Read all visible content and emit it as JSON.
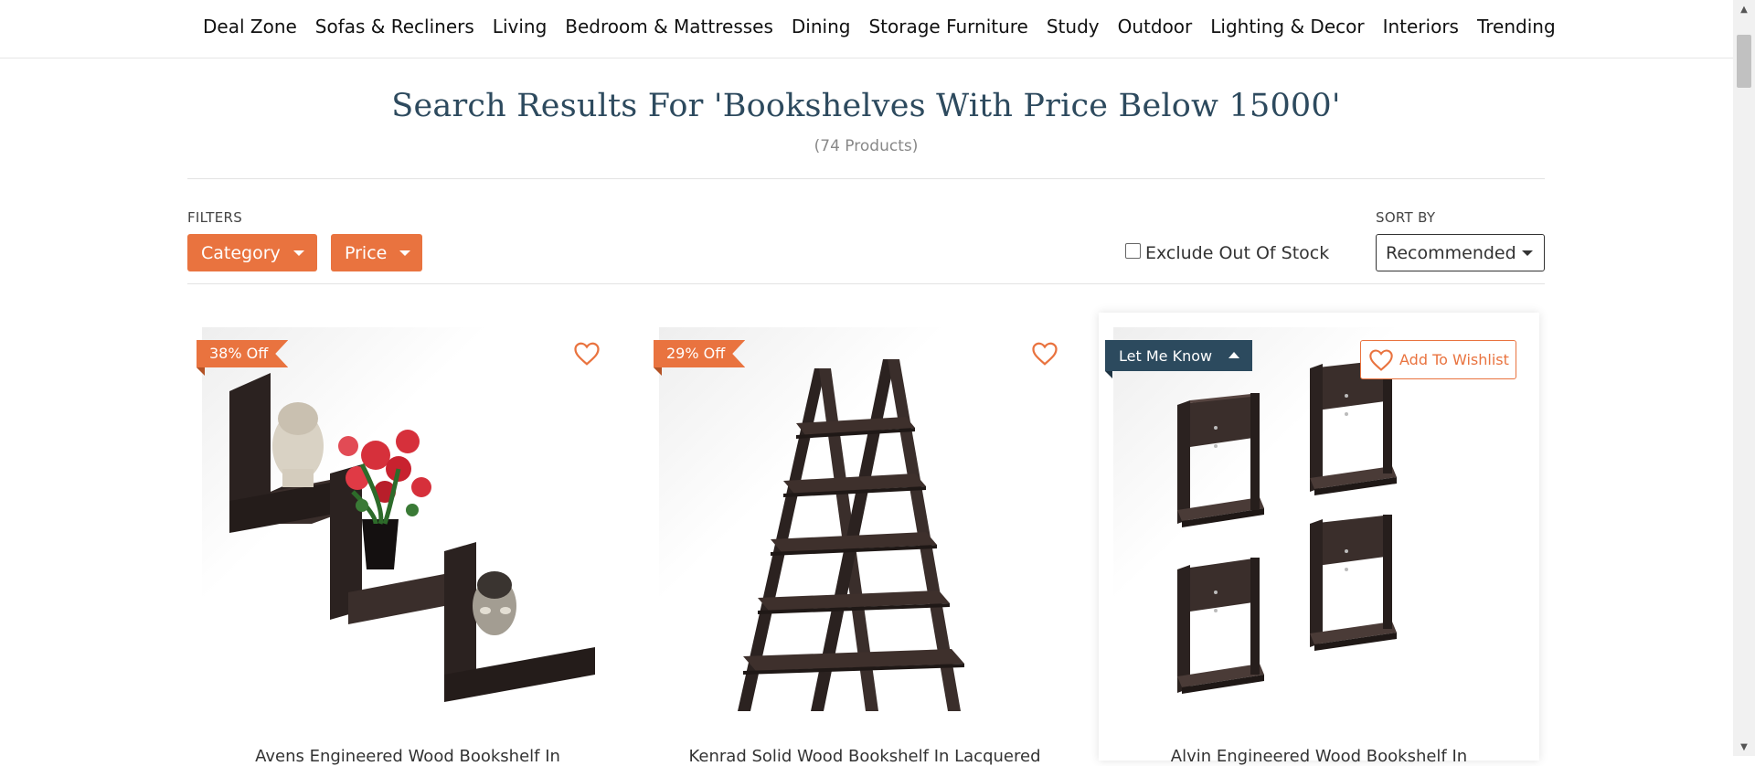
{
  "nav": {
    "items": [
      "Deal Zone",
      "Sofas & Recliners",
      "Living",
      "Bedroom & Mattresses",
      "Dining",
      "Storage Furniture",
      "Study",
      "Outdoor",
      "Lighting & Decor",
      "Interiors",
      "Trending"
    ]
  },
  "header": {
    "title": "Search Results For 'Bookshelves With Price Below 15000'",
    "count": "(74 Products)"
  },
  "filters": {
    "label": "FILTERS",
    "category_label": "Category",
    "price_label": "Price",
    "exclude_label": "Exclude Out Of Stock",
    "exclude_checked": false
  },
  "sort": {
    "label": "SORT BY",
    "selected": "Recommended"
  },
  "products": [
    {
      "discount": "38% Off",
      "title": "Avens Engineered Wood Bookshelf In"
    },
    {
      "discount": "29% Off",
      "title": "Kenrad Solid Wood Bookshelf In Lacquered"
    },
    {
      "let_me_know": "Let Me Know",
      "wishlist_label": "Add To Wishlist",
      "title": "Alvin Engineered Wood Bookshelf In"
    }
  ],
  "colors": {
    "accent": "#e9733f",
    "navy": "#2c4a5e",
    "title": "#2d4a5e"
  }
}
